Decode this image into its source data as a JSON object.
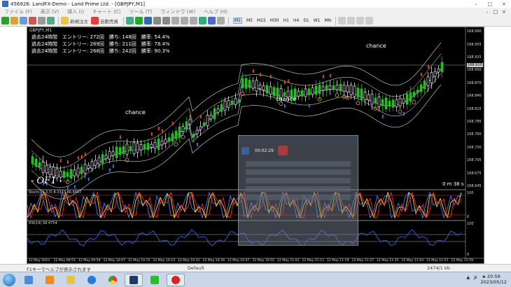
{
  "titlebar": {
    "title": "456926: LandFX-Demo - Land Prime Ltd. - [GBPJPY,M1]",
    "buttons": [
      "–",
      "□",
      "×"
    ]
  },
  "menu": {
    "items": [
      "ファイル (F)",
      "表示 (V)",
      "挿入 (I)",
      "チャート (C)",
      "ツール (T)",
      "ウィンドウ (W)",
      "ヘルプ (H)"
    ]
  },
  "toolbar": {
    "new_order_label": "新規注文",
    "autotrade_label": "自動売買",
    "timeframes": [
      "M1",
      "M5",
      "M15",
      "M30",
      "H1",
      "H4",
      "D1",
      "W1",
      "MN"
    ],
    "active_timeframe": "M1"
  },
  "chart": {
    "symbol_label": "GBPJPY,M1",
    "stats": [
      "過去24時間　エントリー: 272回　勝ち: 148回　勝率: 54.4%",
      "過去24時間　エントリー: 269回　勝ち: 211回　勝率: 78.4%",
      "過去24時間　エントリー: 268回　勝ち: 242回　勝率: 90.3%"
    ],
    "brand_text": "- OF1 -",
    "timer": "0 m 38 s",
    "chance_labels": [
      "chance",
      "chance",
      "chance"
    ],
    "price_ticks": [
      "168.990",
      "168.955",
      "168.925",
      "168.900",
      "168.870",
      "168.840",
      "168.815",
      "168.785",
      "168.760",
      "168.730",
      "168.705",
      "168.675",
      "168.645"
    ],
    "current_price": "168.910",
    "stoch_label": "Stoch(14,3,3) 8.3333 66.6667",
    "stoch_levels": [
      "100",
      "0"
    ],
    "rsi_label": "RSI(14) 58.4754",
    "rsi_levels": [
      "100",
      "0"
    ],
    "time_ticks": [
      "12 May 2023",
      "12 May 09:51",
      "12 May 09:59",
      "12 May 10:07",
      "12 May 10:15",
      "12 May 10:23",
      "12 May 10:31",
      "12 May 10:39",
      "12 May 10:47",
      "12 May 10:55",
      "12 May 11:03",
      "12 May 11:11",
      "12 May 11:19",
      "12 May 11:27",
      "12 May 11:35",
      "12 May 11:43",
      "12 May 11:51",
      "12 May 11:59"
    ]
  },
  "overlay": {
    "time": "00:02:29",
    "fields": [
      "",
      "",
      "",
      "",
      ""
    ]
  },
  "statusbar": {
    "help": "F1キーでヘルプが表示されます",
    "profile": "Default",
    "traffic": "2474/1 kb"
  },
  "taskbar": {
    "apps": [
      "windows-explorer",
      "media-player",
      "file-manager",
      "internet-explorer",
      "chrome",
      "metatrader",
      "line",
      "recorder"
    ],
    "tray": [
      "▲",
      "🔊",
      "⚑"
    ],
    "clock_time": "20:59",
    "clock_date": "2023/05/12"
  },
  "colors": {
    "chart_bg": "#000000",
    "bull_candle": "#22c022",
    "bear_candle": "#ffffff",
    "sell_arrow": "#ff4a1a",
    "buy_arrow": "#3a7bff",
    "stoch_main": "#ff2020",
    "stoch_signal": "#ffe000",
    "stoch_extra": "#4a7bff",
    "rsi_line": "#3a6bff"
  }
}
